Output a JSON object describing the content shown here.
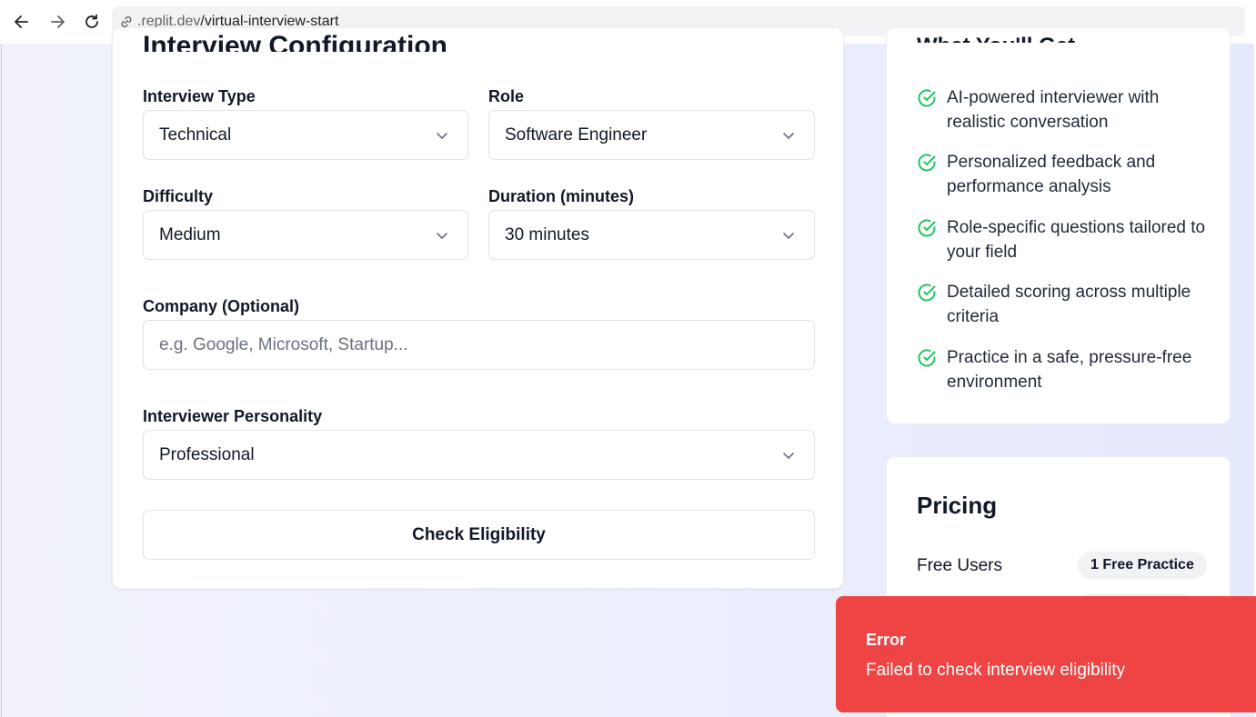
{
  "browser": {
    "url_host": ".replit.dev",
    "url_path": "/virtual-interview-start"
  },
  "config": {
    "title": "Interview Configuration",
    "interview_type": {
      "label": "Interview Type",
      "value": "Technical"
    },
    "role": {
      "label": "Role",
      "value": "Software Engineer"
    },
    "difficulty": {
      "label": "Difficulty",
      "value": "Medium"
    },
    "duration": {
      "label": "Duration (minutes)",
      "value": "30 minutes"
    },
    "company": {
      "label": "Company (Optional)",
      "placeholder": "e.g. Google, Microsoft, Startup..."
    },
    "personality": {
      "label": "Interviewer Personality",
      "value": "Professional"
    },
    "submit_label": "Check Eligibility"
  },
  "features": {
    "title": "What You'll Get",
    "items": [
      {
        "text": "AI-powered interviewer with realistic conversation"
      },
      {
        "text": "Personalized feedback and performance analysis"
      },
      {
        "text": "Role-specific questions tailored to your field"
      },
      {
        "text": "Detailed scoring across multiple criteria"
      },
      {
        "text": "Practice in a safe, pressure-free environment"
      }
    ],
    "check_color": "#22c55e"
  },
  "pricing": {
    "title": "Pricing",
    "rows": [
      {
        "label": "Free Users",
        "badge": "1 Free Practice"
      }
    ]
  },
  "toast": {
    "title": "Error",
    "message": "Failed to check interview eligibility",
    "color": "#ef4444"
  }
}
